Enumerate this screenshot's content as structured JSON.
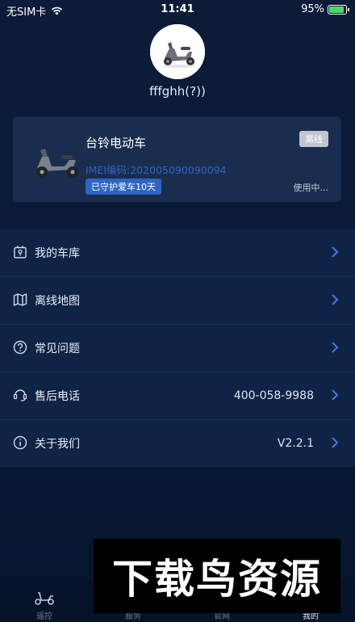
{
  "status_bar": {
    "carrier": "无SIM卡",
    "time": "11:41",
    "battery_text": "95%",
    "battery_level": 0.95
  },
  "profile": {
    "nickname": "fffghh(?))"
  },
  "vehicle_card": {
    "name": "台铃电动车",
    "imei": "IMEI编码:202005090090094",
    "protect_days": "已守护爱车10天",
    "status_badge": "离线",
    "usage": "使用中..."
  },
  "menu": {
    "items": [
      {
        "label": "我的车库",
        "value": "",
        "icon": "garage-icon"
      },
      {
        "label": "离线地图",
        "value": "",
        "icon": "map-icon"
      },
      {
        "label": "常见问题",
        "value": "",
        "icon": "question-icon"
      },
      {
        "label": "售后电话",
        "value": "400-058-9988",
        "icon": "phone-support-icon"
      },
      {
        "label": "关于我们",
        "value": "V2.2.1",
        "icon": "info-icon"
      }
    ]
  },
  "tabbar": {
    "tabs": [
      {
        "label": "遥控"
      },
      {
        "label": "服务"
      },
      {
        "label": "官网"
      },
      {
        "label": "我的"
      }
    ],
    "active_index": 3
  },
  "watermark": {
    "text": "下载鸟资源"
  },
  "colors": {
    "background": "#0a1a38",
    "card": "#1a2d4e",
    "menu_bg": "#0f2346",
    "accent_blue": "#2e64c2",
    "chevron_blue": "#3f7ee0"
  }
}
